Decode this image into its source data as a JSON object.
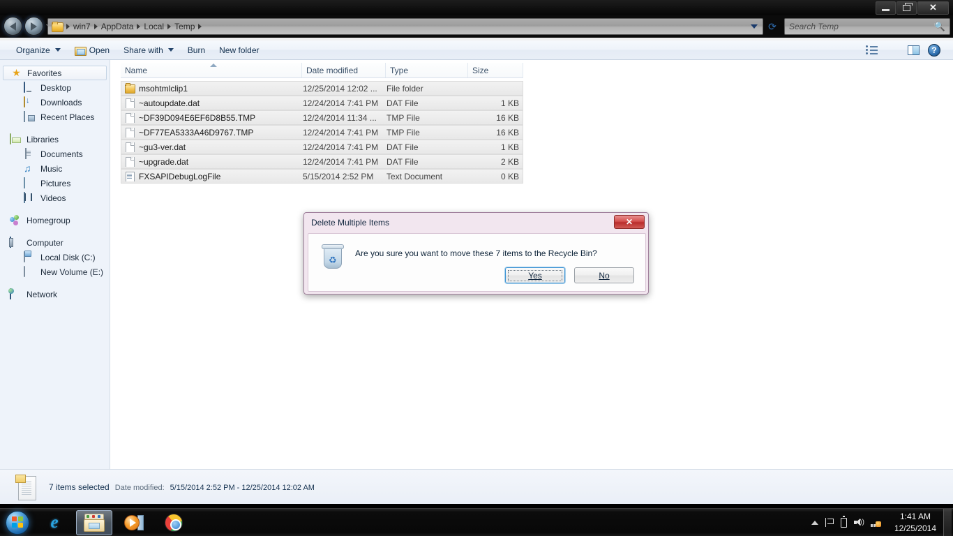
{
  "window": {
    "controls": {
      "minimize": "Minimize",
      "maximize": "Maximize",
      "close": "Close"
    }
  },
  "address": {
    "breadcrumbs": [
      "win7",
      "AppData",
      "Local",
      "Temp"
    ],
    "dropdown_label": "Previous locations",
    "refresh_label": "Refresh"
  },
  "search": {
    "placeholder": "Search Temp"
  },
  "toolbar": {
    "organize": "Organize",
    "open": "Open",
    "share_with": "Share with",
    "burn": "Burn",
    "new_folder": "New folder",
    "view_label": "Change your view",
    "preview_label": "Show the preview pane",
    "help_label": "Get help"
  },
  "sidebar": {
    "groups": [
      {
        "root": {
          "label": "Favorites",
          "icon": "star-icon",
          "selected": true
        },
        "children": [
          {
            "label": "Desktop",
            "icon": "desktop-icon"
          },
          {
            "label": "Downloads",
            "icon": "downloads-icon"
          },
          {
            "label": "Recent Places",
            "icon": "recent-places-icon"
          }
        ]
      },
      {
        "root": {
          "label": "Libraries",
          "icon": "libraries-icon",
          "selected": false
        },
        "children": [
          {
            "label": "Documents",
            "icon": "documents-icon"
          },
          {
            "label": "Music",
            "icon": "music-icon"
          },
          {
            "label": "Pictures",
            "icon": "pictures-icon"
          },
          {
            "label": "Videos",
            "icon": "videos-icon"
          }
        ]
      },
      {
        "root": {
          "label": "Homegroup",
          "icon": "homegroup-icon",
          "selected": false
        },
        "children": []
      },
      {
        "root": {
          "label": "Computer",
          "icon": "computer-icon",
          "selected": false
        },
        "children": [
          {
            "label": "Local Disk (C:)",
            "icon": "local-disk-icon"
          },
          {
            "label": "New Volume (E:)",
            "icon": "volume-icon"
          }
        ]
      },
      {
        "root": {
          "label": "Network",
          "icon": "network-icon",
          "selected": false
        },
        "children": []
      }
    ]
  },
  "filelist": {
    "columns": [
      "Name",
      "Date modified",
      "Type",
      "Size"
    ],
    "sort_column": "Name",
    "sort_direction": "ascending",
    "rows": [
      {
        "name": "msohtmlclip1",
        "date": "12/25/2014 12:02 ...",
        "type": "File folder",
        "size": "",
        "icon": "folder-icon",
        "selected": true
      },
      {
        "name": "~autoupdate.dat",
        "date": "12/24/2014 7:41 PM",
        "type": "DAT File",
        "size": "1 KB",
        "icon": "file-icon",
        "selected": true
      },
      {
        "name": "~DF39D094E6EF6D8B55.TMP",
        "date": "12/24/2014 11:34 ...",
        "type": "TMP File",
        "size": "16 KB",
        "icon": "file-icon",
        "selected": true
      },
      {
        "name": "~DF77EA5333A46D9767.TMP",
        "date": "12/24/2014 7:41 PM",
        "type": "TMP File",
        "size": "16 KB",
        "icon": "file-icon",
        "selected": true
      },
      {
        "name": "~gu3-ver.dat",
        "date": "12/24/2014 7:41 PM",
        "type": "DAT File",
        "size": "1 KB",
        "icon": "file-icon",
        "selected": true
      },
      {
        "name": "~upgrade.dat",
        "date": "12/24/2014 7:41 PM",
        "type": "DAT File",
        "size": "2 KB",
        "icon": "file-icon",
        "selected": true
      },
      {
        "name": "FXSAPIDebugLogFile",
        "date": "5/15/2014 2:52 PM",
        "type": "Text Document",
        "size": "0 KB",
        "icon": "text-file-icon",
        "selected": true
      }
    ]
  },
  "statusbar": {
    "selection": "7 items selected",
    "date_label": "Date modified:",
    "date_value": "5/15/2014 2:52 PM - 12/25/2014 12:02 AM"
  },
  "dialog": {
    "title": "Delete Multiple Items",
    "close_label": "Close",
    "icon": "recycle-bin-icon",
    "message": "Are you sure you want to move these 7 items to the Recycle Bin?",
    "buttons": [
      {
        "label": "Yes",
        "accel": "Y",
        "focused": true
      },
      {
        "label": "No",
        "accel": "N",
        "focused": false
      }
    ]
  },
  "taskbar": {
    "start_label": "Start",
    "items": [
      {
        "label": "Internet Explorer",
        "icon": "internet-explorer-icon",
        "active": false
      },
      {
        "label": "Windows Explorer",
        "icon": "windows-explorer-icon",
        "active": true
      },
      {
        "label": "Windows Media Player",
        "icon": "media-player-icon",
        "active": false
      },
      {
        "label": "Google Chrome",
        "icon": "chrome-icon",
        "active": false
      }
    ],
    "tray": [
      {
        "name": "show-hidden-icons-icon"
      },
      {
        "name": "action-center-flag-icon"
      },
      {
        "name": "battery-icon"
      },
      {
        "name": "volume-icon"
      },
      {
        "name": "network-icon"
      }
    ],
    "clock": {
      "time": "1:41 AM",
      "date": "12/25/2014"
    },
    "show_desktop_label": "Show desktop"
  },
  "colors": {
    "accent": "#2f6fb5",
    "dialog_frame": "#9f7f9b",
    "selection": "#e8e8e8",
    "taskbar": "#0a0a0a"
  }
}
